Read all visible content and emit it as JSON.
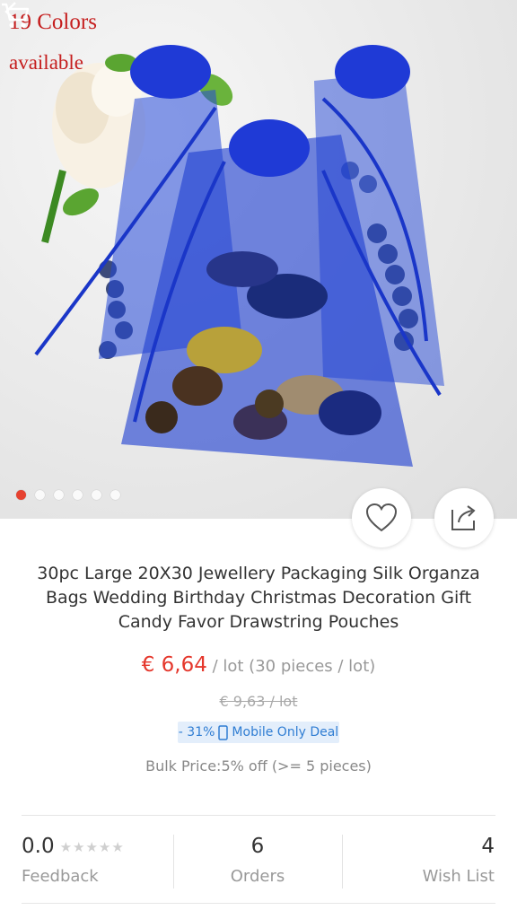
{
  "hero": {
    "overlay_line1": "19 Colors",
    "overlay_line2": "available",
    "image_subject": "blue organza drawstring bags",
    "slide_count": 6,
    "active_slide": 1
  },
  "icons": {
    "back": "chevron-left-icon",
    "cart": "shopping-cart-icon",
    "favorite": "heart-icon",
    "share": "share-icon",
    "device": "phone-icon"
  },
  "product": {
    "title": "30pc Large 20X30 Jewellery Packaging Silk Organza Bags Wedding Birthday Christmas Decoration Gift Candy Favor Drawstring Pouches",
    "price": "€ 6,64",
    "unit": " / lot (30 pieces / lot)",
    "original_price": "€ 9,63 / lot",
    "deal_discount": "- 31%",
    "deal_label": "Mobile Only Deal",
    "bulk_price": "Bulk Price:5% off (>= 5 pieces)"
  },
  "stats": {
    "rating_value": "0.0",
    "rating_stars": "★★★★★",
    "feedback_label": "Feedback",
    "orders_value": "6",
    "orders_label": "Orders",
    "wishlist_value": "4",
    "wishlist_label": "Wish List"
  },
  "colors": {
    "price_red": "#e5372c",
    "accent_blue": "#2f7dd3",
    "bag_blue": "#1f3fd0",
    "active_dot": "#e64230"
  }
}
